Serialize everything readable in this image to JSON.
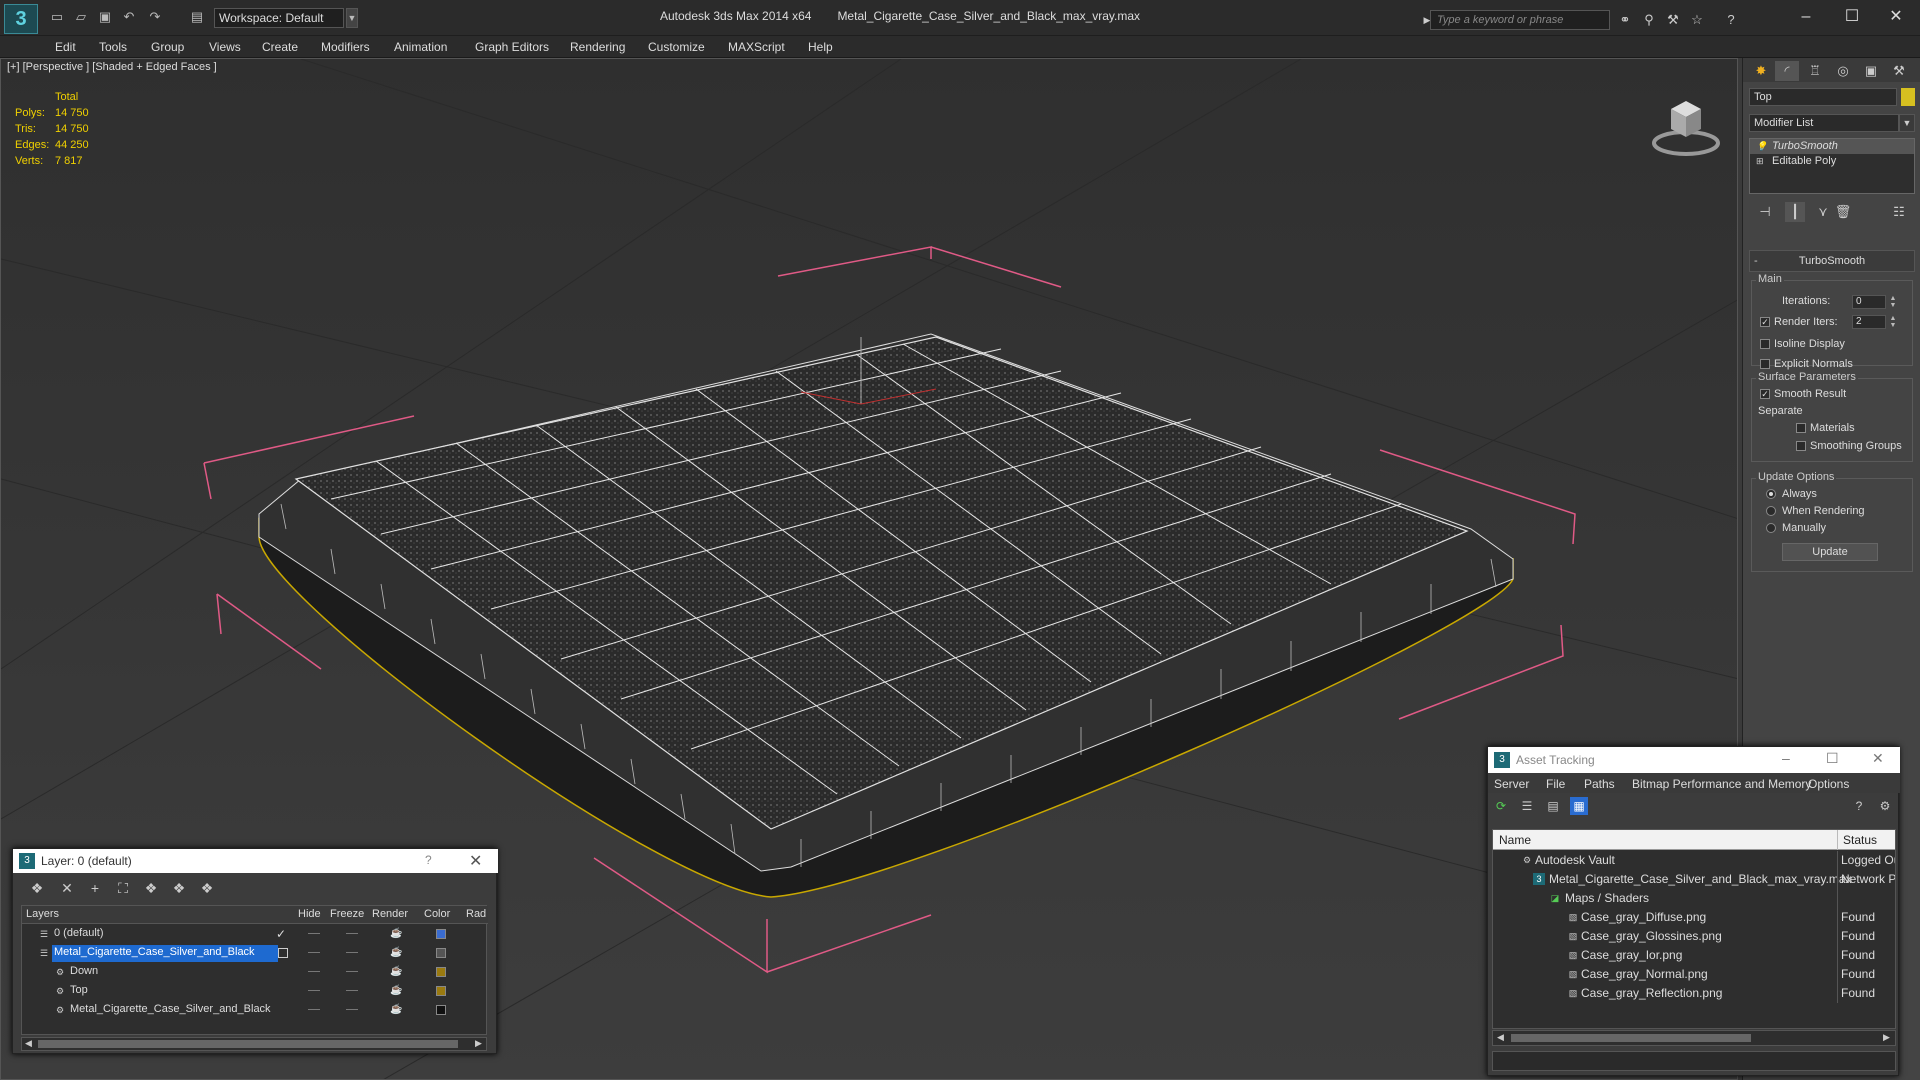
{
  "titlebar": {
    "workspace": "Workspace: Default",
    "app_name": "Autodesk 3ds Max  2014 x64",
    "file_name": "Metal_Cigarette_Case_Silver_and_Black_max_vray.max",
    "search_placeholder": "Type a keyword or phrase"
  },
  "menu": [
    "Edit",
    "Tools",
    "Group",
    "Views",
    "Create",
    "Modifiers",
    "Animation",
    "Graph Editors",
    "Rendering",
    "Customize",
    "MAXScript",
    "Help"
  ],
  "viewport": {
    "label": "[+] [Perspective ] [Shaded + Edged Faces ]",
    "stats_header": "Total",
    "stats": [
      {
        "k": "Polys:",
        "v": "14 750"
      },
      {
        "k": "Tris:",
        "v": "14 750"
      },
      {
        "k": "Edges:",
        "v": "44 250"
      },
      {
        "k": "Verts:",
        "v": "7 817"
      }
    ]
  },
  "command_panel": {
    "object_name": "Top",
    "object_color": "#d6c020",
    "modifier_list": "Modifier List",
    "stack": [
      "TurboSmooth",
      "Editable Poly"
    ],
    "rollout_title": "TurboSmooth",
    "main_group": "Main",
    "iterations_label": "Iterations:",
    "iterations_value": "0",
    "render_iters_label": "Render Iters:",
    "render_iters_value": "2",
    "isoline": "Isoline Display",
    "explicit": "Explicit Normals",
    "surface_group": "Surface Parameters",
    "smooth_result": "Smooth Result",
    "separate": "Separate",
    "materials": "Materials",
    "smoothing_groups": "Smoothing Groups",
    "update_group": "Update Options",
    "always": "Always",
    "when_rendering": "When Rendering",
    "manually": "Manually",
    "update_btn": "Update"
  },
  "layer_window": {
    "title": "Layer: 0 (default)",
    "help": "?",
    "columns": {
      "layers": "Layers",
      "hide": "Hide",
      "freeze": "Freeze",
      "render": "Render",
      "color": "Color",
      "rad": "Rad"
    },
    "rows": [
      {
        "name": "0 (default)",
        "color": "#3a6cd0"
      },
      {
        "name": "Metal_Cigarette_Case_Silver_and_Black",
        "color": "#555555"
      },
      {
        "name": "Down",
        "color": "#9a7a10"
      },
      {
        "name": "Top",
        "color": "#9a7a10"
      },
      {
        "name": "Metal_Cigarette_Case_Silver_and_Black",
        "color": "#111111"
      }
    ]
  },
  "asset_window": {
    "title": "Asset Tracking",
    "menu": [
      "Server",
      "File",
      "Paths",
      "Bitmap Performance and Memory",
      "Options"
    ],
    "col_name": "Name",
    "col_status": "Status",
    "rows": [
      {
        "name": "Autodesk Vault",
        "status": "Logged Ou"
      },
      {
        "name": "Metal_Cigarette_Case_Silver_and_Black_max_vray.max",
        "status": "Network P"
      },
      {
        "name": "Maps / Shaders",
        "status": ""
      },
      {
        "name": "Case_gray_Diffuse.png",
        "status": "Found"
      },
      {
        "name": "Case_gray_Glossines.png",
        "status": "Found"
      },
      {
        "name": "Case_gray_Ior.png",
        "status": "Found"
      },
      {
        "name": "Case_gray_Normal.png",
        "status": "Found"
      },
      {
        "name": "Case_gray_Reflection.png",
        "status": "Found"
      }
    ]
  }
}
